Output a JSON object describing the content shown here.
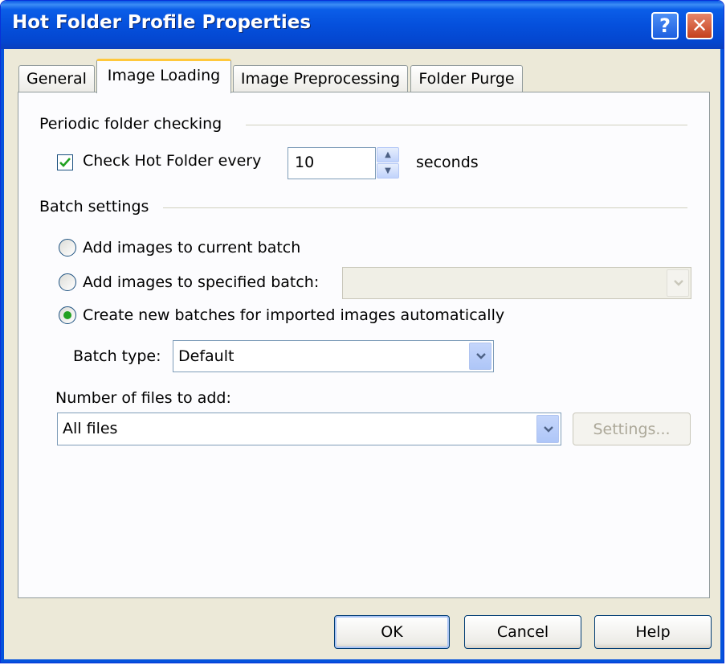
{
  "window": {
    "title": "Hot Folder Profile Properties",
    "help_glyph": "?",
    "close_glyph": "✕"
  },
  "tabs": [
    {
      "label": "General",
      "active": false
    },
    {
      "label": "Image Loading",
      "active": true
    },
    {
      "label": "Image Preprocessing",
      "active": false
    },
    {
      "label": "Folder Purge",
      "active": false
    }
  ],
  "periodic": {
    "group_label": "Periodic folder checking",
    "check_label": "Check Hot Folder every",
    "checked": true,
    "interval_value": "10",
    "unit_label": "seconds"
  },
  "batch": {
    "group_label": "Batch settings",
    "options": [
      {
        "label": "Add images to current batch",
        "selected": false
      },
      {
        "label": "Add images to specified batch:",
        "selected": false
      },
      {
        "label": "Create new batches for imported images automatically",
        "selected": true
      }
    ],
    "specified_batch_value": "",
    "batch_type_label": "Batch type:",
    "batch_type_value": "Default",
    "files_label": "Number of files to add:",
    "files_value": "All files",
    "settings_button": "Settings..."
  },
  "buttons": {
    "ok": "OK",
    "cancel": "Cancel",
    "help": "Help"
  },
  "colors": {
    "titlebar": "#0550dc",
    "face": "#ece9d8",
    "active_tab_accent": "#ffc83c",
    "check_green": "#21a121"
  }
}
